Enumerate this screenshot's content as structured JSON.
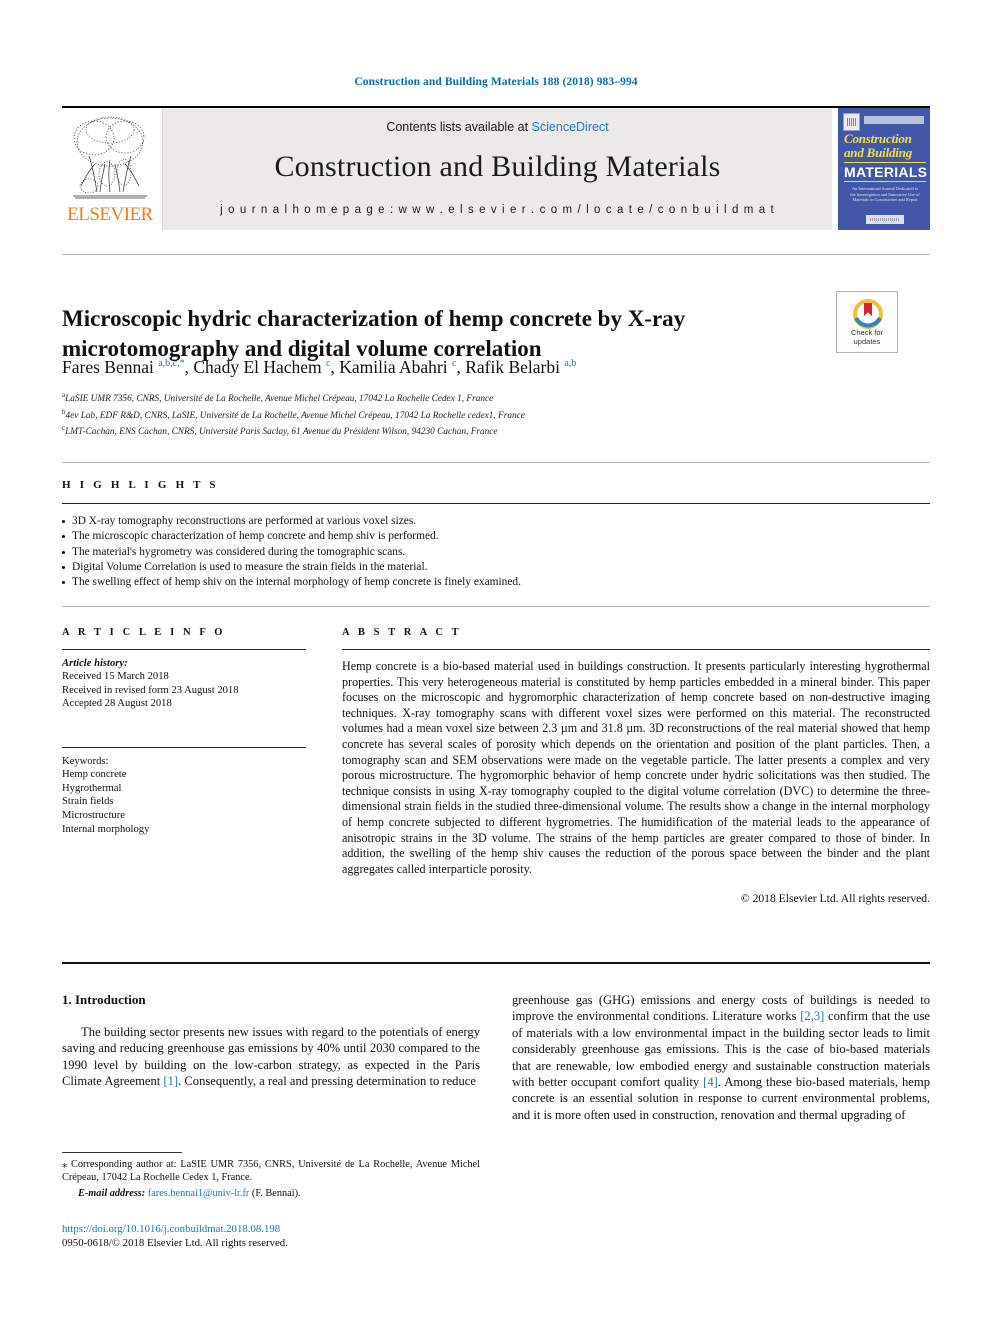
{
  "running_head": "Construction and Building Materials 188 (2018) 983–994",
  "masthead": {
    "publisher_name": "ELSEVIER",
    "contents_prefix": "Contents lists available at",
    "contents_link": "ScienceDirect",
    "journal_title": "Construction and Building Materials",
    "homepage_line": "j o u r n a l   h o m e p a g e :   w w w . e l s e v i e r . c o m / l o c a t e / c o n b u i l d m a t",
    "cover": {
      "line1": "Construction",
      "line2": "and Building",
      "line3": "MATERIALS",
      "blurb": "An International Journal Dedicated to the Investigation and Innovative Use of Materials in Construction and Repair"
    }
  },
  "article": {
    "title": "Microscopic hydric characterization of hemp concrete by X-ray microtomography and digital volume correlation",
    "crossmark_label": "Check for updates",
    "authors_html": "Fares Bennai <sup>a,b,c,*</sup>, Chady El Hachem <sup>c</sup>, Kamilia Abahri <sup>c</sup>, Rafik Belarbi <sup>a,b</sup>",
    "affiliations": [
      {
        "marker": "a",
        "text": "LaSIE UMR 7356, CNRS, Université de La Rochelle, Avenue Michel Crépeau, 17042 La Rochelle Cedex 1, France"
      },
      {
        "marker": "b",
        "text": "4ev Lab, EDF R&D, CNRS, LaSIE, Université de La Rochelle, Avenue Michel Crépeau, 17042 La Rochelle cedex1, France"
      },
      {
        "marker": "c",
        "text": "LMT-Cachan, ENS Cachan, CNRS, Université Paris Saclay, 61 Avenue du Président Wilson, 94230 Cachan, France"
      }
    ]
  },
  "highlights": {
    "heading": "H I G H L I G H T S",
    "items": [
      "3D X-ray tomography reconstructions are performed at various voxel sizes.",
      "The microscopic characterization of hemp concrete and hemp shiv is performed.",
      "The material's hygrometry was considered during the tomographic scans.",
      "Digital Volume Correlation is used to measure the strain fields in the material.",
      "The swelling effect of hemp shiv on the internal morphology of hemp concrete is finely examined."
    ]
  },
  "article_info": {
    "heading": "A R T I C L E   I N F O",
    "history_label": "Article history:",
    "history": [
      "Received 15 March 2018",
      "Received in revised form 23 August 2018",
      "Accepted 28 August 2018"
    ],
    "keywords_label": "Keywords:",
    "keywords": [
      "Hemp concrete",
      "Hygrothermal",
      "Strain fields",
      "Microstructure",
      "Internal morphology"
    ]
  },
  "abstract": {
    "heading": "A B S T R A C T",
    "text": "Hemp concrete is a bio-based material used in buildings construction. It presents particularly interesting hygrothermal properties. This very heterogeneous material is constituted by hemp particles embedded in a mineral binder. This paper focuses on the microscopic and hygromorphic characterization of hemp concrete based on non-destructive imaging techniques. X-ray tomography scans with different voxel sizes were performed on this material. The reconstructed volumes had a mean voxel size between 2.3 µm and 31.8 µm. 3D reconstructions of the real material showed that hemp concrete has several scales of porosity which depends on the orientation and position of the plant particles. Then, a tomography scan and SEM observations were made on the vegetable particle. The latter presents a complex and very porous microstructure. The hygromorphic behavior of hemp concrete under hydric solicitations was then studied. The technique consists in using X-ray tomography coupled to the digital volume correlation (DVC) to determine the three-dimensional strain fields in the studied three-dimensional volume. The results show a change in the internal morphology of hemp concrete subjected to different hygrometries. The humidification of the material leads to the appearance of anisotropic strains in the 3D volume. The strains of the hemp particles are greater compared to those of binder. In addition, the swelling of the hemp shiv causes the reduction of the porous space between the binder and the plant aggregates called interparticle porosity.",
    "copyright": "© 2018 Elsevier Ltd. All rights reserved."
  },
  "body": {
    "section_number_title": "1. Introduction",
    "left_paragraph_pre": "The building sector presents new issues with regard to the potentials of energy saving and reducing greenhouse gas emissions by 40% until 2030 compared to the 1990 level by building on the low-carbon strategy, as expected in the Paris Climate Agreement ",
    "left_ref_1": "[1]",
    "left_paragraph_post": ". Consequently, a real and pressing determination to reduce",
    "right_paragraph_pre": "greenhouse gas (GHG) emissions and energy costs of buildings is needed to improve the environmental conditions. Literature works ",
    "right_ref_23": "[2,3]",
    "right_paragraph_mid": " confirm that the use of materials with a low environmental impact in the building sector leads to limit considerably greenhouse gas emissions. This is the case of bio-based materials that are renewable, low embodied energy and sustainable construction materials with better occupant comfort quality ",
    "right_ref_4": "[4]",
    "right_paragraph_post": ". Among these bio-based materials, hemp concrete is an essential solution in response to current environmental problems, and it is more often used in construction, renovation and thermal upgrading of"
  },
  "footnotes": {
    "corresponding_marker": "⁎",
    "corresponding_text": "Corresponding author at: LaSIE UMR 7356, CNRS, Université de La Rochelle, Avenue Michel Crépeau, 17042 La Rochelle Cedex 1, France.",
    "email_label": "E-mail address:",
    "email": "fares.bennai1@univ-lr.fr",
    "email_owner": "(F. Bennai).",
    "doi_url": "https://doi.org/10.1016/j.conbuildmat.2018.08.198",
    "issn_line": "0950-0618/© 2018 Elsevier Ltd. All rights reserved."
  },
  "colors": {
    "link_blue": "#1976b5",
    "sciencedirect_blue": "#2a7ab5",
    "running_head_blue": "#0b6ea8",
    "elsevier_orange": "#f07f1a",
    "cover_blue": "#4257a8",
    "cover_yellow": "#f3e03a"
  }
}
